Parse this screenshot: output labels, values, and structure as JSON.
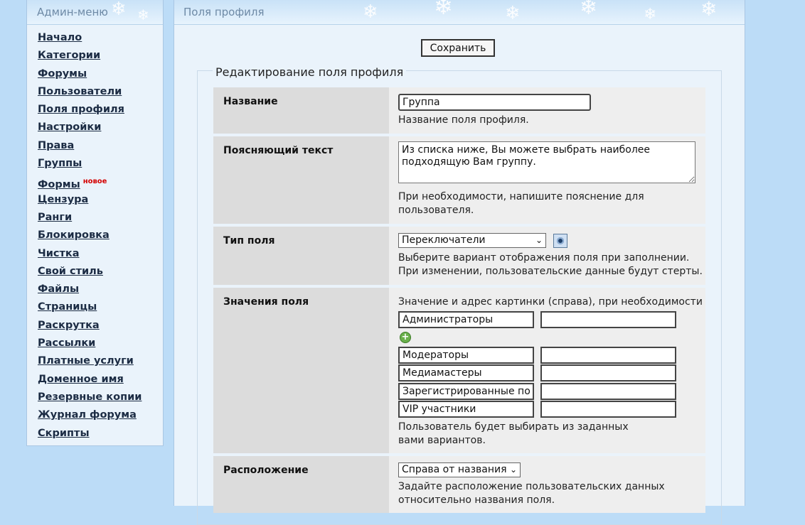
{
  "sidebar": {
    "title": "Админ-меню",
    "items": [
      {
        "label": "Начало"
      },
      {
        "label": "Категории"
      },
      {
        "label": "Форумы"
      },
      {
        "label": "Пользователи"
      },
      {
        "label": "Поля профиля"
      },
      {
        "label": "Настройки"
      },
      {
        "label": "Права"
      },
      {
        "label": "Группы"
      },
      {
        "label": "Формы",
        "badge": "новое"
      },
      {
        "label": "Цензура"
      },
      {
        "label": "Ранги"
      },
      {
        "label": "Блокировка"
      },
      {
        "label": "Чистка"
      },
      {
        "label": "Свой стиль"
      },
      {
        "label": "Файлы"
      },
      {
        "label": "Страницы"
      },
      {
        "label": "Раскрутка"
      },
      {
        "label": "Рассылки"
      },
      {
        "label": "Платные услуги"
      },
      {
        "label": "Доменное имя"
      },
      {
        "label": "Резервные копии"
      },
      {
        "label": "Журнал форума"
      },
      {
        "label": "Скрипты"
      }
    ]
  },
  "main": {
    "title": "Поля профиля",
    "save_label": "Сохранить",
    "legend": "Редактирование поля профиля"
  },
  "form": {
    "name": {
      "label": "Название",
      "value": "Группа",
      "hint": "Название поля профиля."
    },
    "description": {
      "label": "Поясняющий текст",
      "value": "Из списка ниже, Вы можете выбрать наиболее подходящую Вам группу.",
      "hint": "При необходимости, напишите пояснение для пользователя."
    },
    "type": {
      "label": "Тип поля",
      "selected": "Переключатели",
      "hint_line1": "Выберите вариант отображения поля при заполнении.",
      "hint_line2": "При изменении, пользовательские данные будут стерты."
    },
    "values": {
      "label": "Значения поля",
      "header": "Значение и адрес картинки (справа), при необходимости",
      "options": [
        "Администраторы",
        "Модераторы",
        "Медиамастеры",
        "Зарегистрированные пол",
        "VIP участники"
      ],
      "hint": "Пользователь будет выбирать из заданных вами вариантов."
    },
    "position": {
      "label": "Расположение",
      "selected": "Справа от названия",
      "hint": "Задайте расположение пользовательских данных относительно названия поля."
    }
  },
  "colors": {
    "background": "#bcdcf7",
    "panel": "#eaf3fb",
    "label_cell": "#dcdcdc",
    "content_cell": "#eeeeee",
    "badge": "#d40000"
  }
}
